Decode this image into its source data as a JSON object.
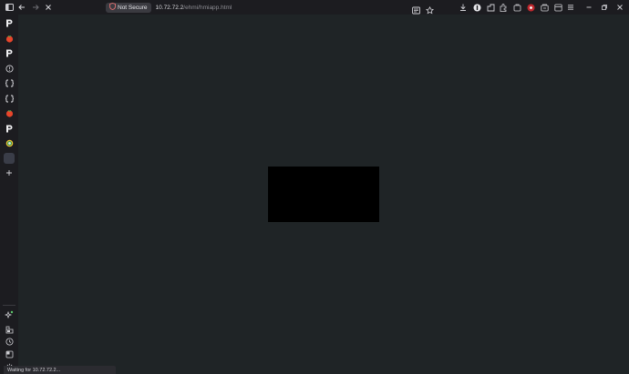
{
  "window": {
    "security_label": "Not Secure",
    "url_host": "10.72.72.2",
    "url_path": "/ehmi/hmiapp.html"
  },
  "status": {
    "text": "Waiting for 10.72.72.2..."
  },
  "icons": {
    "toolbar": [
      "sidebar-toggle-icon",
      "back-icon",
      "forward-icon",
      "stop-icon"
    ],
    "address_right": [
      "reader-mode-icon",
      "bookmark-star-icon"
    ],
    "extensions": [
      "download-icon",
      "extension-icon",
      "extension-icon",
      "extensions-puzzle-icon",
      "extension-red-icon",
      "wallet-icon",
      "tab-manager-icon",
      "menu-icon"
    ],
    "window_controls": [
      "minimize-icon",
      "restore-icon",
      "close-icon"
    ],
    "sidebar_top": [
      "pinned-tab-p",
      "pinned-tab-tomato",
      "pinned-tab-p",
      "pinned-tab-circle",
      "pinned-tab-brackets",
      "pinned-tab-brackets",
      "pinned-tab-tomato",
      "pinned-tab-p",
      "pinned-tab-chrome",
      "active-tab",
      "new-tab-plus"
    ],
    "sidebar_bottom": [
      "ai-sparkle-icon",
      "split-view-icon",
      "history-icon",
      "panel-icon",
      "settings-icon"
    ]
  }
}
